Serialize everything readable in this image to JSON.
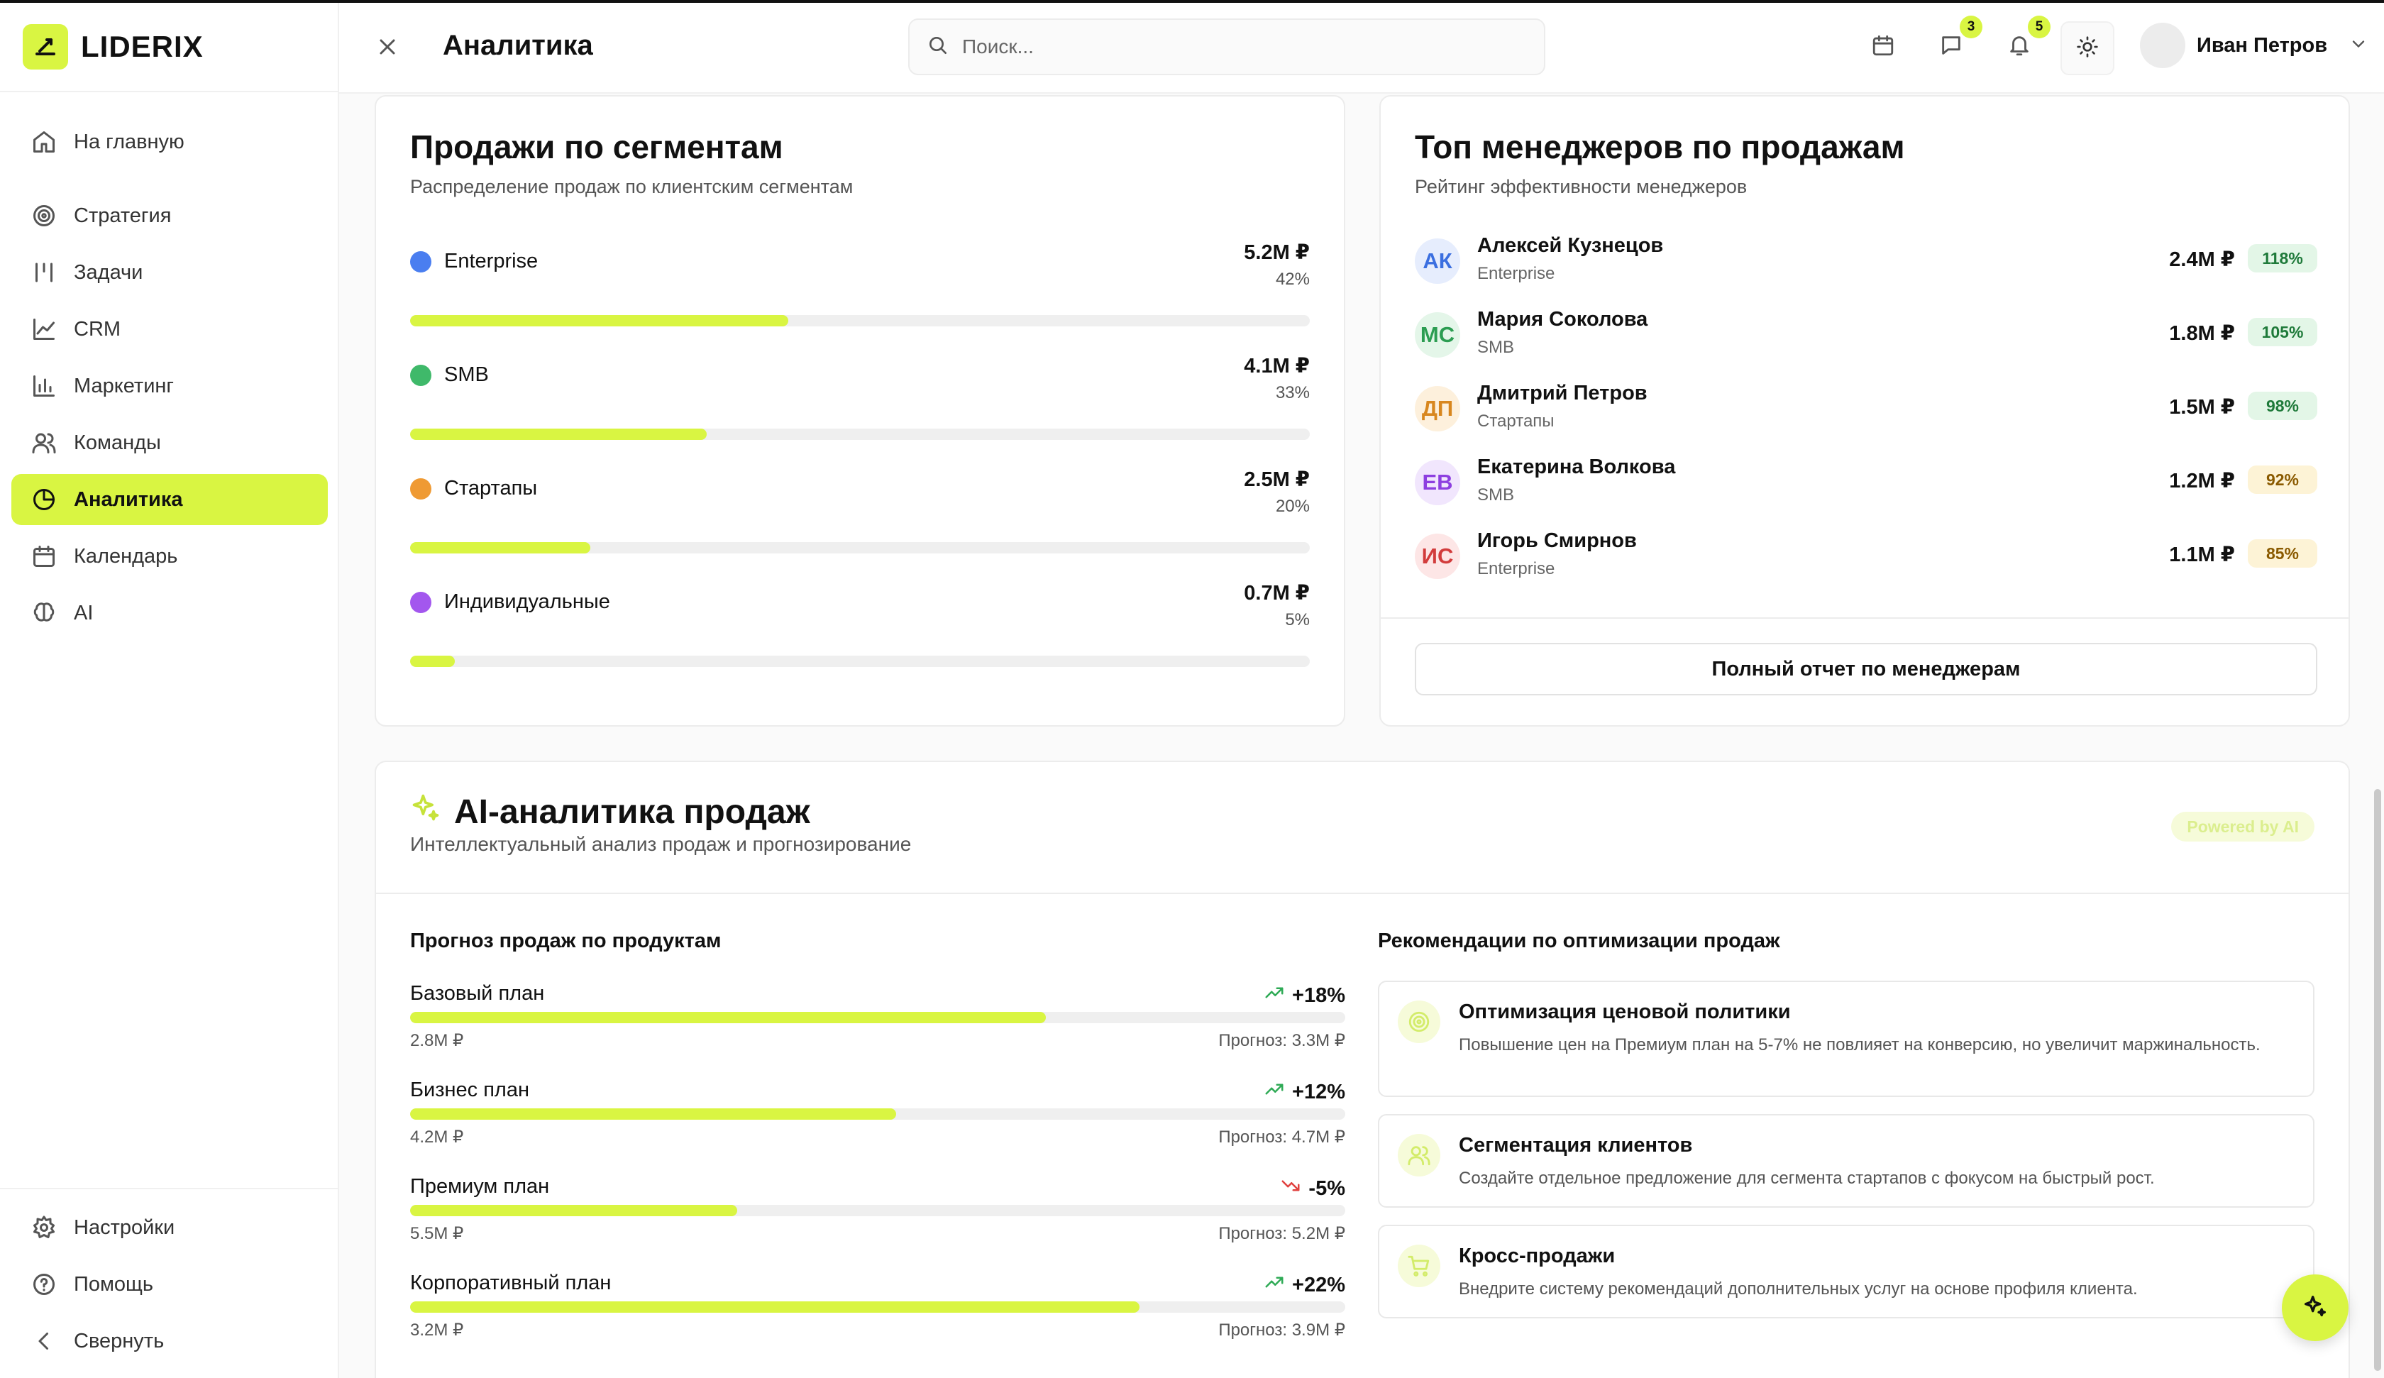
{
  "brand": {
    "name": "LIDERIX",
    "accent": "#d9f542"
  },
  "sidebar": {
    "items": [
      {
        "label": "На главную",
        "icon": "home-icon"
      },
      {
        "label": "Стратегия",
        "icon": "target-icon"
      },
      {
        "label": "Задачи",
        "icon": "tasks-icon"
      },
      {
        "label": "CRM",
        "icon": "chart-line-icon"
      },
      {
        "label": "Маркетинг",
        "icon": "bar-chart-icon"
      },
      {
        "label": "Команды",
        "icon": "users-icon"
      },
      {
        "label": "Аналитика",
        "icon": "pie-chart-icon",
        "active": true
      },
      {
        "label": "Календарь",
        "icon": "calendar-icon"
      },
      {
        "label": "AI",
        "icon": "brain-icon"
      }
    ],
    "bottom": [
      {
        "label": "Настройки",
        "icon": "gear-icon"
      },
      {
        "label": "Помощь",
        "icon": "help-icon"
      },
      {
        "label": "Свернуть",
        "icon": "chevron-left-icon"
      }
    ]
  },
  "header": {
    "title": "Аналитика",
    "search_placeholder": "Поиск...",
    "messages_count": "3",
    "notifications_count": "5",
    "user_name": "Иван Петров"
  },
  "segments": {
    "title": "Продажи по сегментам",
    "subtitle": "Распределение продаж по клиентским сегментам",
    "items": [
      {
        "name": "Enterprise",
        "value": "5.2M ₽",
        "percent": "42%",
        "share": 42,
        "color": "#4a7ef0"
      },
      {
        "name": "SMB",
        "value": "4.1M ₽",
        "percent": "33%",
        "share": 33,
        "color": "#3fb96a"
      },
      {
        "name": "Стартапы",
        "value": "2.5M ₽",
        "percent": "20%",
        "share": 20,
        "color": "#ef9a33"
      },
      {
        "name": "Индивидуальные",
        "value": "0.7M ₽",
        "percent": "5%",
        "share": 5,
        "color": "#a357ee"
      }
    ]
  },
  "managers": {
    "title": "Топ менеджеров по продажам",
    "subtitle": "Рейтинг эффективности менеджеров",
    "items": [
      {
        "initials": "АК",
        "name": "Алексей Кузнецов",
        "segment": "Enterprise",
        "amount": "2.4M ₽",
        "percent": "118%",
        "avatar_bg": "#e6edfd",
        "avatar_fg": "#3b6fe0",
        "badge_bg": "#e3f6e7",
        "badge_fg": "#1f7a3a"
      },
      {
        "initials": "МС",
        "name": "Мария Соколова",
        "segment": "SMB",
        "amount": "1.8M ₽",
        "percent": "105%",
        "avatar_bg": "#e4f6e9",
        "avatar_fg": "#2c9d52",
        "badge_bg": "#e3f6e7",
        "badge_fg": "#1f7a3a"
      },
      {
        "initials": "ДП",
        "name": "Дмитрий Петров",
        "segment": "Стартапы",
        "amount": "1.5M ₽",
        "percent": "98%",
        "avatar_bg": "#fdf0dc",
        "avatar_fg": "#d8871f",
        "badge_bg": "#e3f6e7",
        "badge_fg": "#1f7a3a"
      },
      {
        "initials": "ЕВ",
        "name": "Екатерина Волкова",
        "segment": "SMB",
        "amount": "1.2M ₽",
        "percent": "92%",
        "avatar_bg": "#f1e6fd",
        "avatar_fg": "#8d3fe0",
        "badge_bg": "#fdf3d6",
        "badge_fg": "#8a5a00"
      },
      {
        "initials": "ИС",
        "name": "Игорь Смирнов",
        "segment": "Enterprise",
        "amount": "1.1M ₽",
        "percent": "85%",
        "avatar_bg": "#fde6e6",
        "avatar_fg": "#d23c3c",
        "badge_bg": "#fdf3d6",
        "badge_fg": "#8a5a00"
      }
    ],
    "report_button": "Полный отчет по менеджерам"
  },
  "ai": {
    "title": "AI-аналитика продаж",
    "subtitle": "Интеллектуальный анализ продаж и прогнозирование",
    "powered": "Powered by AI",
    "forecast_title": "Прогноз продаж по продуктам",
    "products": [
      {
        "name": "Базовый план",
        "change": "+18%",
        "trend": "up",
        "current": "2.8M ₽",
        "forecast": "Прогноз: 3.3M ₽",
        "progress": 68
      },
      {
        "name": "Бизнес план",
        "change": "+12%",
        "trend": "up",
        "current": "4.2M ₽",
        "forecast": "Прогноз: 4.7M ₽",
        "progress": 52
      },
      {
        "name": "Премиум план",
        "change": "-5%",
        "trend": "down",
        "current": "5.5M ₽",
        "forecast": "Прогноз: 5.2M ₽",
        "progress": 35
      },
      {
        "name": "Корпоративный план",
        "change": "+22%",
        "trend": "up",
        "current": "3.2M ₽",
        "forecast": "Прогноз: 3.9M ₽",
        "progress": 78
      }
    ],
    "recs_title": "Рекомендации по оптимизации продаж",
    "recommendations": [
      {
        "icon": "target-icon",
        "title": "Оптимизация ценовой политики",
        "text": "Повышение цен на Премиум план на 5-7% не повлияет на конверсию, но увеличит маржинальность."
      },
      {
        "icon": "users-icon",
        "title": "Сегментация клиентов",
        "text": "Создайте отдельное предложение для сегмента стартапов с фокусом на быстрый рост."
      },
      {
        "icon": "cart-icon",
        "title": "Кросс-продажи",
        "text": "Внедрите систему рекомендаций дополнительных услуг на основе профиля клиента."
      }
    ]
  }
}
